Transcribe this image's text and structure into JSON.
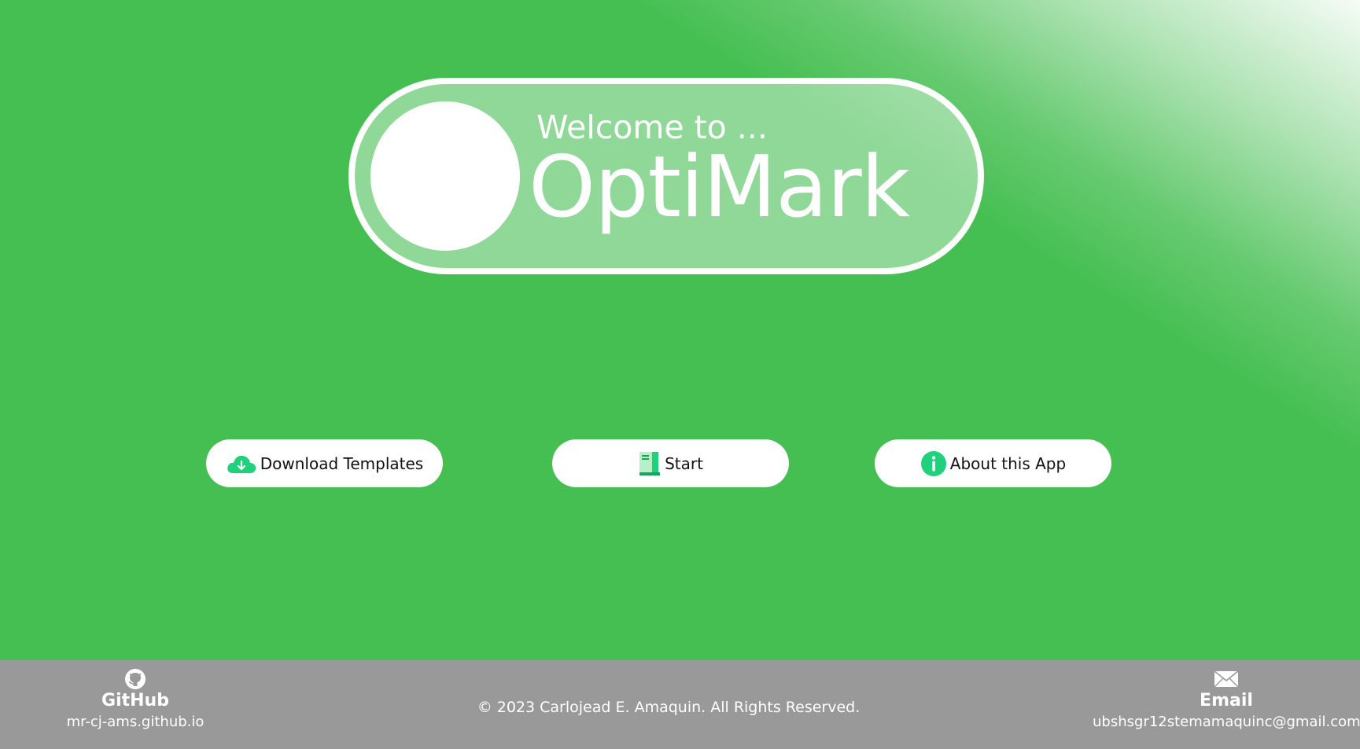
{
  "hero": {
    "welcome_text": "Welcome to ...",
    "brand_name": "OptiMark"
  },
  "actions": {
    "download_label": "Download Templates",
    "download_icon": "cloud-download-icon",
    "start_label": "Start",
    "start_icon": "book-icon",
    "about_label": "About this App",
    "about_icon": "info-icon"
  },
  "footer": {
    "github_title": "GitHub",
    "github_link": "mr-cj-ams.github.io",
    "github_icon": "github-icon",
    "copyright": "© 2023 Carlojead E. Amaquin. All Rights Reserved.",
    "email_title": "Email",
    "email_address": "ubshsgr12stemamaquinc@gmail.com",
    "email_icon": "mail-icon"
  },
  "colors": {
    "background": "#46bf52",
    "footer": "#999999",
    "accent_icon": "#1fd17a"
  }
}
